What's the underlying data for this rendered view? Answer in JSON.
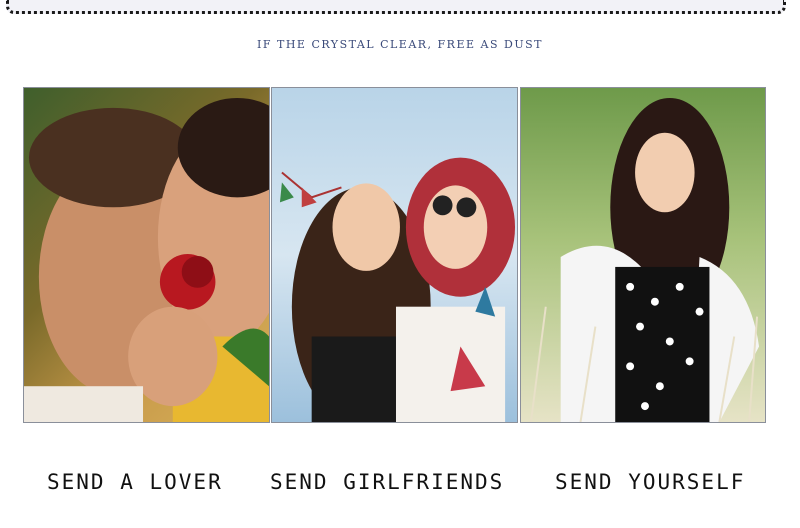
{
  "tagline": "IF THE CRYSTAL CLEAR, FREE AS DUST",
  "photos": [
    {
      "id": "couple-rose-photo",
      "caption": "SEND A LOVER"
    },
    {
      "id": "girlfriends-photo",
      "caption": "SEND GIRLFRIENDS"
    },
    {
      "id": "yourself-photo",
      "caption": "SEND YOURSELF"
    }
  ],
  "colors": {
    "tagline": "#3a4a7a",
    "caption": "#111111",
    "border": "#8a8f9a"
  }
}
